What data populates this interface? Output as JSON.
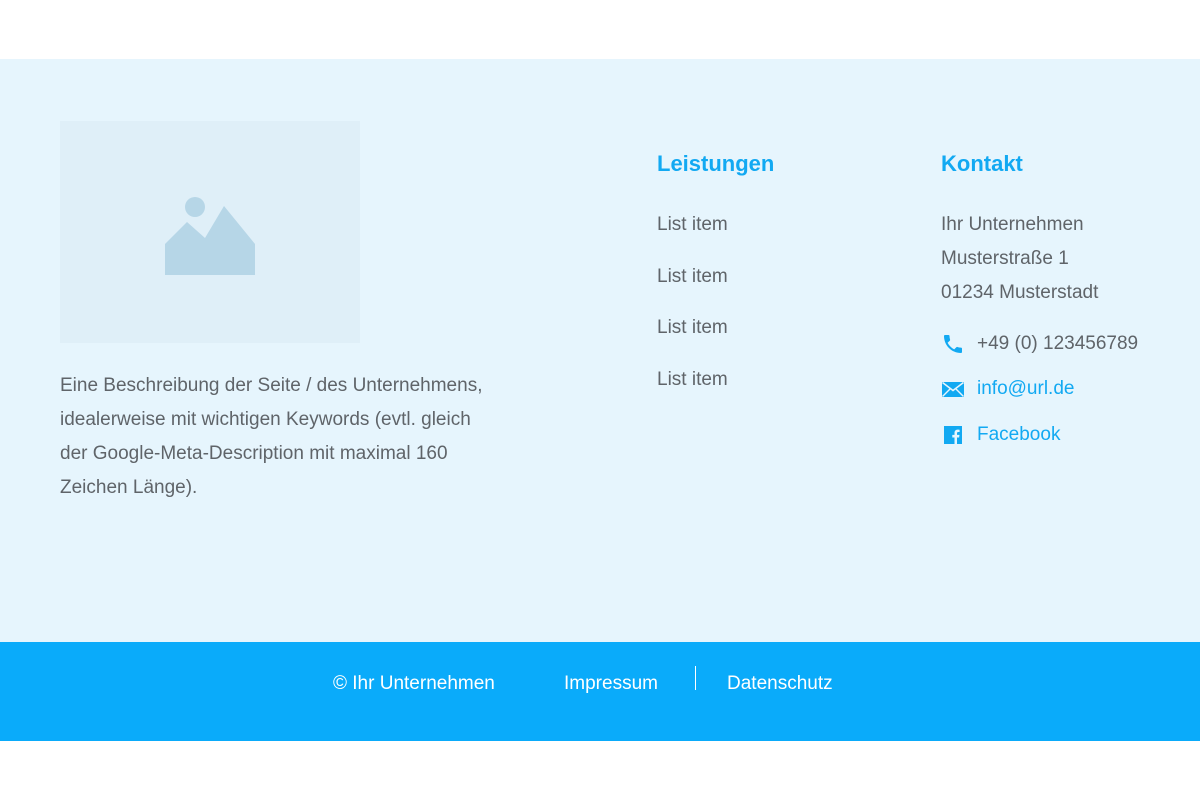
{
  "brand": {
    "logo_placeholder_icon": "image-placeholder-icon",
    "description": "Eine Beschreibung der Seite / des Unternehmens, idealerweise mit wichtigen Keywords (evtl. gleich der Google-Meta-Description mit maximal 160 Zeichen Länge)."
  },
  "services": {
    "title": "Leistungen",
    "items": [
      "List item",
      "List item",
      "List item",
      "List item"
    ]
  },
  "contact": {
    "title": "Kontakt",
    "address": [
      "Ihr Unternehmen",
      "Musterstraße 1",
      "01234 Musterstadt"
    ],
    "phone": {
      "icon": "phone-icon",
      "text": "+49 (0) 123456789"
    },
    "email": {
      "icon": "mail-icon",
      "text": "info@url.de"
    },
    "facebook": {
      "icon": "facebook-icon",
      "text": "Facebook"
    }
  },
  "bottom_bar": {
    "copyright": "© Ihr Unternehmen",
    "impressum": "Impressum",
    "datenschutz": "Datenschutz"
  },
  "colors": {
    "accent": "#12a9f2",
    "footer_background": "#e6f5fd",
    "bottom_bar_background": "#0aabfa",
    "text": "#5f6469"
  }
}
